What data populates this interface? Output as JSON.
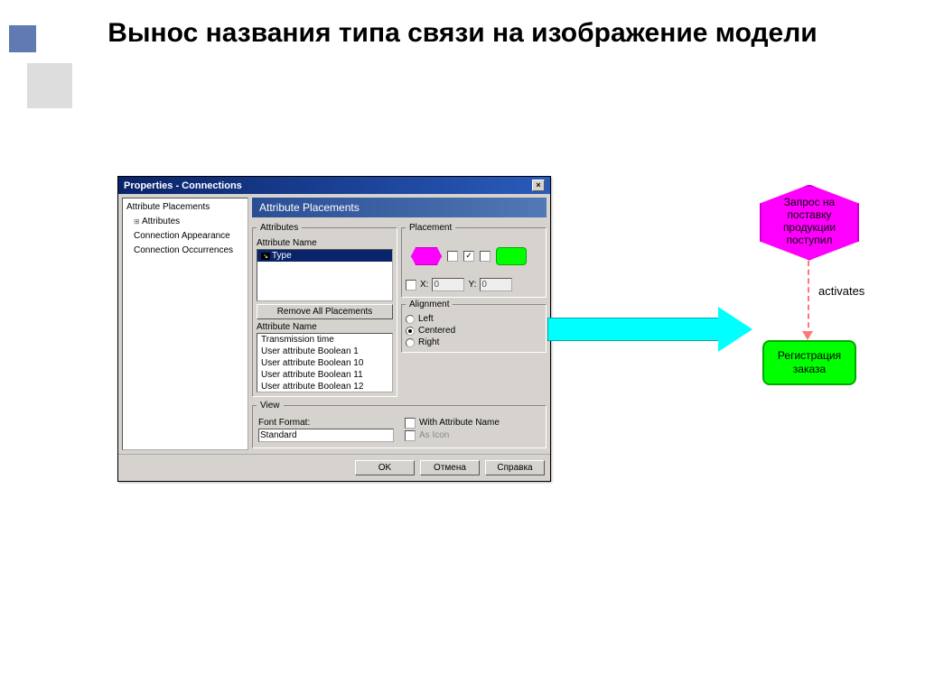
{
  "slide_title": "Вынос названия типа связи на изображение модели",
  "dialog": {
    "title": "Properties - Connections",
    "tree": [
      "Attribute Placements",
      "Attributes",
      "Connection Appearance",
      "Connection Occurrences"
    ],
    "panel_title": "Attribute Placements",
    "attributes": {
      "legend": "Attributes",
      "name_label": "Attribute Name",
      "selected": "Type",
      "remove_btn": "Remove All Placements",
      "name_label2": "Attribute Name",
      "list": [
        "Transmission time",
        "User attribute Boolean 1",
        "User attribute Boolean 10",
        "User attribute Boolean 11",
        "User attribute Boolean 12"
      ]
    },
    "placement": {
      "legend": "Placement",
      "x_label": "X:",
      "x_val": "0",
      "y_label": "Y:",
      "y_val": "0"
    },
    "alignment": {
      "legend": "Alignment",
      "left": "Left",
      "centered": "Centered",
      "right": "Right"
    },
    "view": {
      "legend": "View",
      "font_label": "Font Format:",
      "font_value": "Standard",
      "with_attr": "With Attribute Name",
      "as_icon": "As Icon"
    },
    "buttons": {
      "ok": "OK",
      "cancel": "Отмена",
      "help": "Справка"
    }
  },
  "diagram": {
    "event_text": "Запрос на поставку продукции поступил",
    "conn_label": "activates",
    "func_text": "Регистрация заказа"
  }
}
